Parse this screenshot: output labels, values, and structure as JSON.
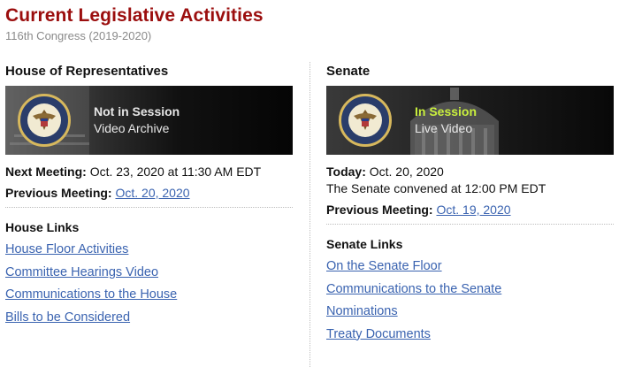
{
  "header": {
    "title": "Current Legislative Activities",
    "subtitle": "116th Congress (2019-2020)"
  },
  "colors": {
    "title": "#9b0e0e",
    "link": "#3a63b0",
    "in_session": "#c9ef3e"
  },
  "house": {
    "heading": "House of Representatives",
    "banner": {
      "status": "Not in Session",
      "sublabel": "Video Archive",
      "seal_icon": "house-seal-icon"
    },
    "next_meeting_label": "Next Meeting:",
    "next_meeting_value": "Oct. 23, 2020 at 11:30 AM EDT",
    "previous_meeting_label": "Previous Meeting:",
    "previous_meeting_value": "Oct. 20, 2020",
    "links_heading": "House Links",
    "links": [
      "House Floor Activities",
      "Committee Hearings Video",
      "Communications to the House",
      "Bills to be Considered"
    ]
  },
  "senate": {
    "heading": "Senate",
    "banner": {
      "status": "In Session",
      "sublabel": "Live Video",
      "seal_icon": "senate-seal-icon"
    },
    "today_label": "Today:",
    "today_value": "Oct. 20, 2020",
    "convened_text": "The Senate convened at 12:00 PM EDT",
    "previous_meeting_label": "Previous Meeting:",
    "previous_meeting_value": "Oct. 19, 2020",
    "links_heading": "Senate Links",
    "links": [
      "On the Senate Floor",
      "Communications to the Senate",
      "Nominations",
      "Treaty Documents"
    ]
  }
}
